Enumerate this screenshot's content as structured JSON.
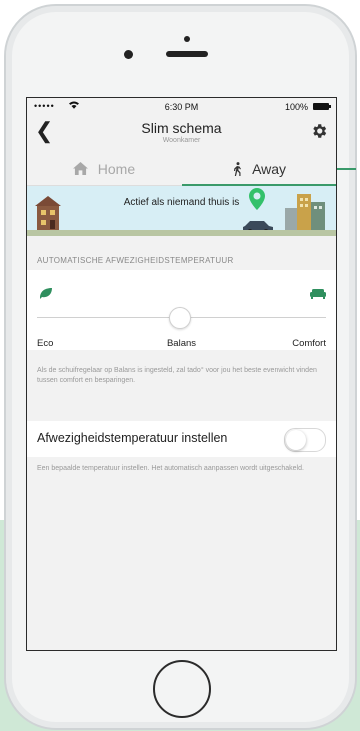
{
  "status_bar": {
    "signal": "•••••",
    "time": "6:30 PM",
    "battery": "100%"
  },
  "header": {
    "title": "Slim schema",
    "subtitle": "Woonkamer"
  },
  "tabs": [
    {
      "label": "Home",
      "icon": "house-icon",
      "active": false
    },
    {
      "label": "Away",
      "icon": "walking-person-icon",
      "active": true
    }
  ],
  "banner": {
    "text": "Actief als niemand thuis is"
  },
  "section_label": "AUTOMATISCHE AFWEZIGHEIDSTEMPERATUUR",
  "slider": {
    "labels": {
      "eco": "Eco",
      "balance": "Balans",
      "comfort": "Comfort"
    },
    "value": 0.5
  },
  "slider_description": "Als de schuifregelaar op Balans is ingesteld, zal tado° voor jou het beste evenwicht vinden tussen comfort en besparingen.",
  "toggle": {
    "label": "Afwezigheidstemperatuur instellen",
    "on": false
  },
  "toggle_description": "Een bepaalde temperatuur instellen. Het automatisch aanpassen wordt uitgeschakeld.",
  "colors": {
    "accent": "#3a9a6a",
    "banner_bg": "#d7eef5",
    "background": "#cfe8d6"
  }
}
